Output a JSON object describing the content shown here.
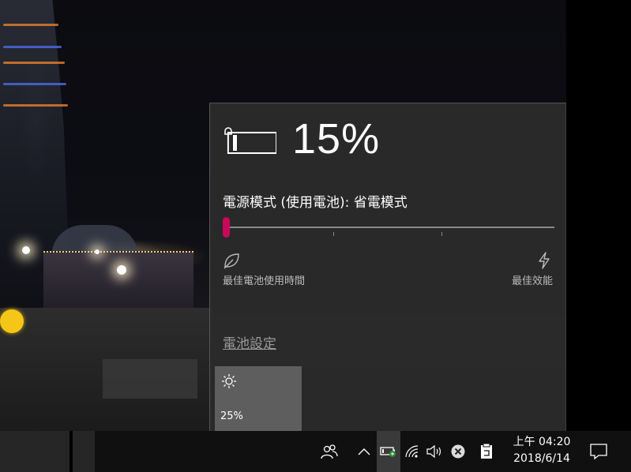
{
  "battery": {
    "percent": "15%",
    "level": 0.15,
    "icon": "battery-charging-plug-icon"
  },
  "power_mode": {
    "label": "電源模式 (使用電池): 省電模式",
    "slider_value": 0,
    "left_label": "最佳電池使用時間",
    "left_icon": "leaf-icon",
    "right_label": "最佳效能",
    "right_icon": "lightning-bolt-icon"
  },
  "links": {
    "battery_settings": "電池設定"
  },
  "quick_action": {
    "icon": "brightness-sun-icon",
    "value": "25%"
  },
  "taskbar": {
    "people_icon": "people-icon",
    "overflow_icon": "chevron-up-icon",
    "tray_icons": [
      "battery-icon",
      "wifi-icon",
      "volume-icon",
      "error-x-icon",
      "clipboard-icon"
    ],
    "clock_time": "上午 04:20",
    "clock_date": "2018/6/14",
    "notification_icon": "action-center-icon"
  },
  "colors": {
    "accent": "#c8095a",
    "flyout_bg": "#2b2b2b",
    "taskbar_bg": "#101010"
  }
}
